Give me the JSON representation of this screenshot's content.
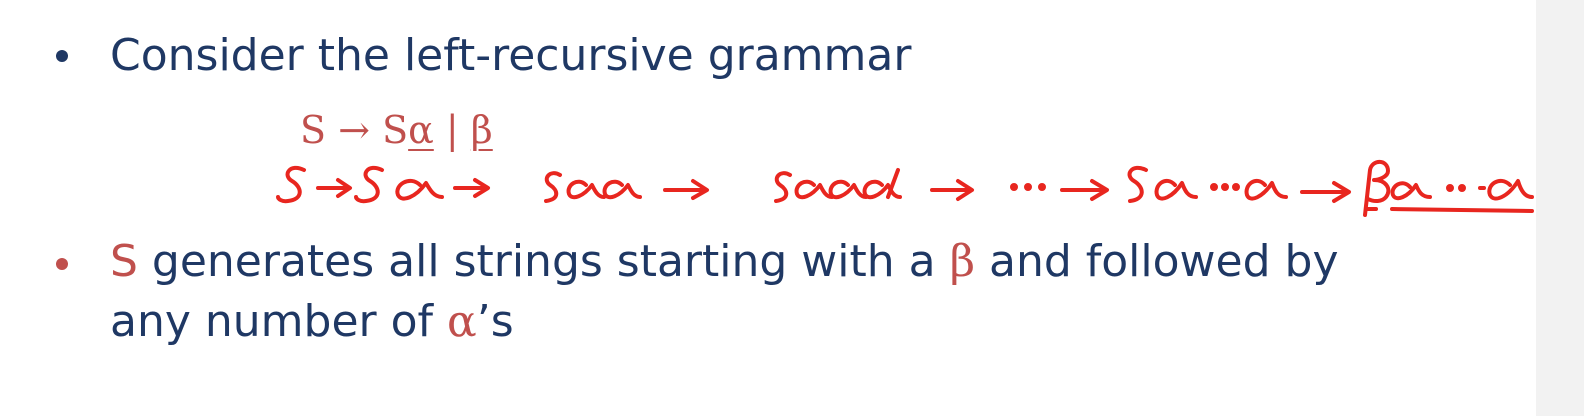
{
  "slide": {
    "bullet1": {
      "text": "Consider the left-recursive grammar"
    },
    "grammar": {
      "lhs": "S",
      "arrow": "→",
      "rhs_start": "S",
      "alpha": "α",
      "bar": "|",
      "beta": "β"
    },
    "handwritten_derivation": {
      "color": "#e8261f"
    },
    "bullet2": {
      "s": "S",
      "part1": " generates all strings starting with a ",
      "beta": "β",
      "part2": " and followed by",
      "part3": "any number of ",
      "alpha": "α",
      "part4": "’s"
    }
  },
  "colors": {
    "text_blue": "#1f3864",
    "accent_red": "#c0504d",
    "ink_red": "#e8261f"
  }
}
